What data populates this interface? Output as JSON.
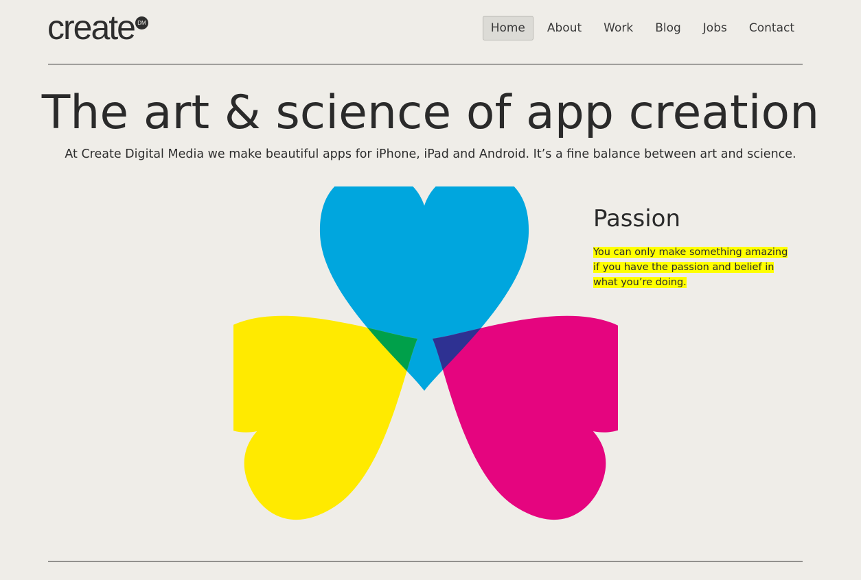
{
  "logo": {
    "text": "create",
    "badge": "DM"
  },
  "nav": {
    "items": [
      {
        "label": "Home",
        "active": true
      },
      {
        "label": "About"
      },
      {
        "label": "Work"
      },
      {
        "label": "Blog"
      },
      {
        "label": "Jobs"
      },
      {
        "label": "Contact"
      }
    ]
  },
  "hero": {
    "title": "The art & science of app creation",
    "subtitle": "At Create Digital Media we make beautiful apps for iPhone, iPad and Android. It’s a fine balance between art and science."
  },
  "graphic": {
    "colors": {
      "cyan": "#00a6de",
      "magenta": "#e5057f",
      "yellow": "#ffea00",
      "blue_overlap": "#2e3192",
      "green_overlap": "#00a04a",
      "red_overlap": "#e31e24",
      "center": "#333333"
    }
  },
  "feature": {
    "title": "Passion",
    "text": "You can only make something amazing if you have the passion and belief in what you’re doing.",
    "highlight_color": "#ffff00"
  }
}
